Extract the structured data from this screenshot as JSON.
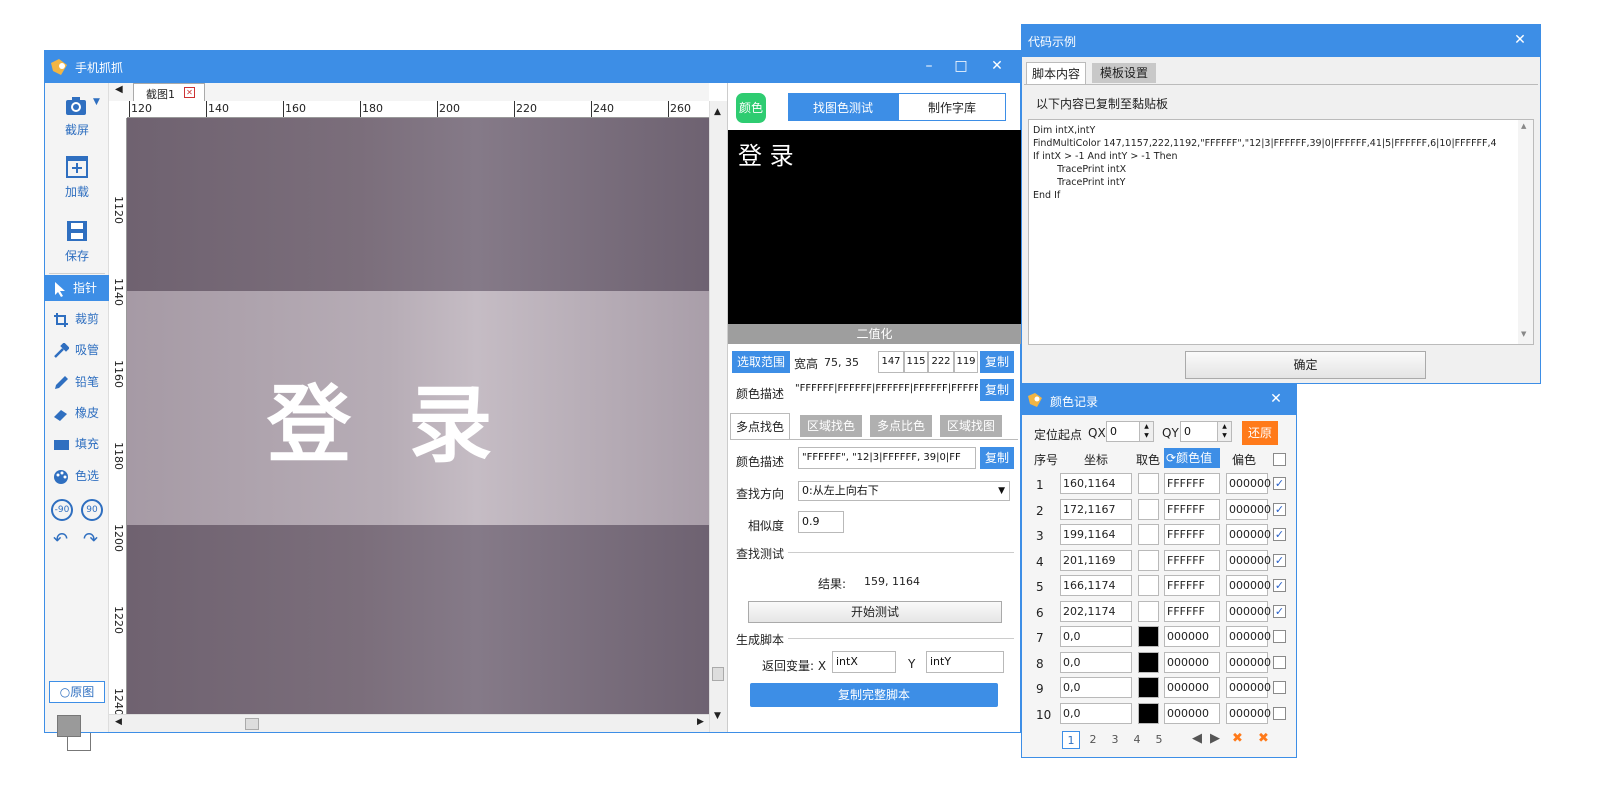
{
  "main_window": {
    "title": "手机抓抓",
    "controls": {
      "minimize": "–",
      "maximize": "□",
      "close": "✕"
    }
  },
  "toolbar": {
    "screenshot": "截屏",
    "load": "加载",
    "save": "保存",
    "pointer": "指针",
    "crop": "裁剪",
    "eyedropper": "吸管",
    "pencil": "铅笔",
    "eraser": "橡皮",
    "fill": "填充",
    "color_select": "色选",
    "rotate_left": "-90",
    "rotate_right": "90",
    "original": "原图"
  },
  "canvas": {
    "tab_label": "截图1",
    "ruler_x": [
      "120",
      "140",
      "160",
      "180",
      "200",
      "220",
      "240",
      "260"
    ],
    "ruler_y": [
      "1120",
      "1140",
      "1160",
      "1180",
      "1200",
      "1220",
      "1240"
    ],
    "image_text": "登 录"
  },
  "right_panel": {
    "color_button": "颜色",
    "tabs": [
      "找图色测试",
      "制作字库"
    ],
    "preview_text": "登 录",
    "binarize_label": "二值化",
    "select_range": "选取范围",
    "wh_label": "宽高",
    "wh_value": "75, 35",
    "coords": [
      "147",
      "115",
      "222",
      "119"
    ],
    "copy": "复制",
    "color_desc_label": "颜色描述",
    "color_desc_value": "\"FFFFFF|FFFFFF|FFFFFF|FFFFFF|FFFFFF",
    "mode_tabs": [
      "多点找色",
      "区域找色",
      "多点比色",
      "区域找图"
    ],
    "multi_desc_label": "颜色描述",
    "multi_desc_value": "\"FFFFFF\", \"12|3|FFFFFF, 39|0|FF",
    "direction_label": "查找方向",
    "direction_value": "0:从左上向右下",
    "similarity_label": "相似度",
    "similarity_value": "0.9",
    "test_section": "查找测试",
    "result_label": "结果:",
    "result_value": "159, 1164",
    "start_test": "开始测试",
    "gen_section": "生成脚本",
    "return_var_label": "返回变量: X",
    "x_var": "intX",
    "y_label": "Y",
    "y_var": "intY",
    "copy_full": "复制完整脚本"
  },
  "code_window": {
    "title": "代码示例",
    "tabs": [
      "脚本内容",
      "模板设置"
    ],
    "notice": "以下内容已复制至黏贴板",
    "code_lines": [
      "Dim intX,intY",
      "FindMultiColor 147,1157,222,1192,\"FFFFFF\",\"12|3|FFFFFF,39|0|FFFFFF,41|5|FFFFFF,6|10|FFFFFF,4",
      "If intX > -1 And intY > -1 Then",
      "        TracePrint intX",
      "        TracePrint intY",
      "End If"
    ],
    "ok": "确定"
  },
  "color_window": {
    "title": "颜色记录",
    "origin_label": "定位起点",
    "qx_label": "QX",
    "qx_value": "0",
    "qy_label": "QY",
    "qy_value": "0",
    "restore": "还原",
    "headers": {
      "index": "序号",
      "coord": "坐标",
      "pick": "取色",
      "value": "颜色值",
      "offset": "偏色"
    },
    "rows": [
      {
        "index": "1",
        "coord": "160,1164",
        "swatch": "#ffffff",
        "value": "FFFFFF",
        "offset": "000000",
        "checked": true
      },
      {
        "index": "2",
        "coord": "172,1167",
        "swatch": "#ffffff",
        "value": "FFFFFF",
        "offset": "000000",
        "checked": true
      },
      {
        "index": "3",
        "coord": "199,1164",
        "swatch": "#ffffff",
        "value": "FFFFFF",
        "offset": "000000",
        "checked": true
      },
      {
        "index": "4",
        "coord": "201,1169",
        "swatch": "#ffffff",
        "value": "FFFFFF",
        "offset": "000000",
        "checked": true
      },
      {
        "index": "5",
        "coord": "166,1174",
        "swatch": "#ffffff",
        "value": "FFFFFF",
        "offset": "000000",
        "checked": true
      },
      {
        "index": "6",
        "coord": "202,1174",
        "swatch": "#ffffff",
        "value": "FFFFFF",
        "offset": "000000",
        "checked": true
      },
      {
        "index": "7",
        "coord": "0,0",
        "swatch": "#000000",
        "value": "000000",
        "offset": "000000",
        "checked": false
      },
      {
        "index": "8",
        "coord": "0,0",
        "swatch": "#000000",
        "value": "000000",
        "offset": "000000",
        "checked": false
      },
      {
        "index": "9",
        "coord": "0,0",
        "swatch": "#000000",
        "value": "000000",
        "offset": "000000",
        "checked": false
      },
      {
        "index": "10",
        "coord": "0,0",
        "swatch": "#000000",
        "value": "000000",
        "offset": "000000",
        "checked": false
      }
    ],
    "pages": [
      "1",
      "2",
      "3",
      "4",
      "5"
    ]
  },
  "colors": {
    "accent": "#3d8ee6",
    "orange": "#ff7a1a",
    "gray_tab": "#b0b0b0",
    "green": "#2ecc71",
    "canvas_bg": "#7b6f7b"
  }
}
